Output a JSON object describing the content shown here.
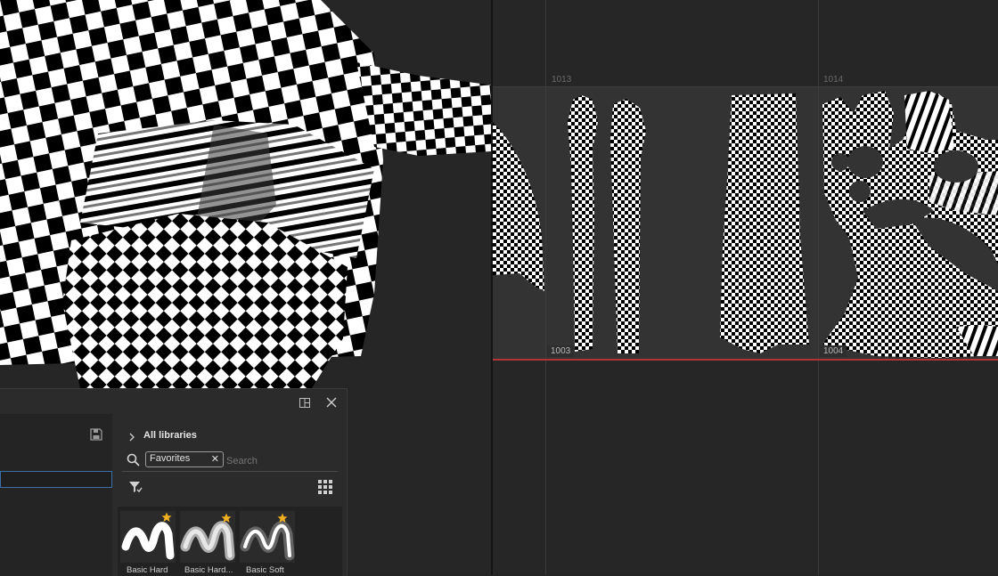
{
  "uv_tiles": {
    "top_left": "1013",
    "top_right": "1014",
    "bottom_left": "1003",
    "bottom_right": "1004"
  },
  "shelf": {
    "breadcrumb": "All libraries",
    "filter_chip": "Favorites",
    "search_placeholder": "Search",
    "brushes": [
      {
        "label": "Basic Hard",
        "favorite": true
      },
      {
        "label": "Basic Hard...",
        "favorite": true
      },
      {
        "label": "Basic Soft",
        "favorite": true
      }
    ]
  },
  "colors": {
    "accent_red_line": "#b23434",
    "favorite_star": "#f0b020"
  }
}
